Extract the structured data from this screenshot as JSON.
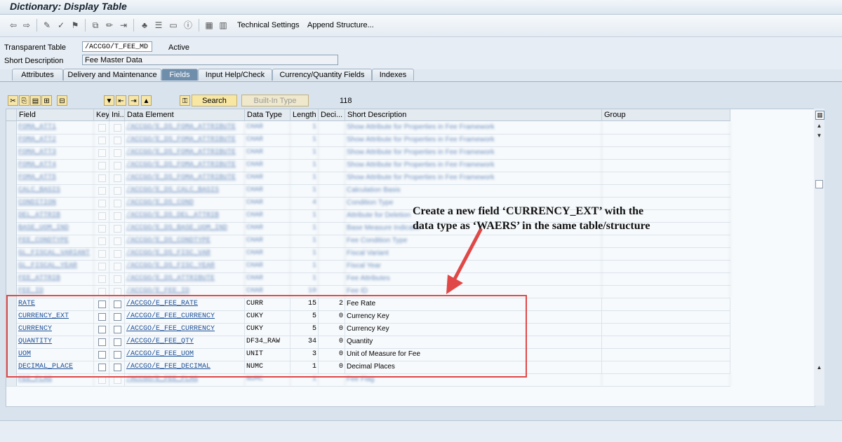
{
  "window": {
    "title": "Dictionary: Display Table"
  },
  "toolbar": {
    "technical_settings": "Technical Settings",
    "append_structure": "Append Structure..."
  },
  "header": {
    "table_type_label": "Transparent Table",
    "table_name": "/ACCGO/T_FEE_MD",
    "status": "Active",
    "short_desc_label": "Short Description",
    "short_desc_value": "Fee Master Data"
  },
  "tabs": [
    {
      "label": "Attributes",
      "active": false
    },
    {
      "label": "Delivery and Maintenance",
      "active": false
    },
    {
      "label": "Fields",
      "active": true
    },
    {
      "label": "Input Help/Check",
      "active": false
    },
    {
      "label": "Currency/Quantity Fields",
      "active": false
    },
    {
      "label": "Indexes",
      "active": false
    }
  ],
  "controls": {
    "search": "Search",
    "builtin_type": "Built-In Type",
    "count": "118"
  },
  "grid": {
    "columns": [
      "Field",
      "Key",
      "Ini...",
      "Data Element",
      "Data Type",
      "Length",
      "Deci...",
      "Short Description",
      "Group"
    ],
    "blurred_rows": [
      {
        "field": "FOMA_ATT1",
        "de": "/ACCGO/E_DS_FOMA_ATTRIBUTE",
        "dtype": "CHAR",
        "len": "1",
        "desc": "Show Attribute for Properties in Fee Framework"
      },
      {
        "field": "FOMA_ATT2",
        "de": "/ACCGO/E_DS_FOMA_ATTRIBUTE",
        "dtype": "CHAR",
        "len": "1",
        "desc": "Show Attribute for Properties in Fee Framework"
      },
      {
        "field": "FOMA_ATT3",
        "de": "/ACCGO/E_DS_FOMA_ATTRIBUTE",
        "dtype": "CHAR",
        "len": "1",
        "desc": "Show Attribute for Properties in Fee Framework"
      },
      {
        "field": "FOMA_ATT4",
        "de": "/ACCGO/E_DS_FOMA_ATTRIBUTE",
        "dtype": "CHAR",
        "len": "1",
        "desc": "Show Attribute for Properties in Fee Framework"
      },
      {
        "field": "FOMA_ATT5",
        "de": "/ACCGO/E_DS_FOMA_ATTRIBUTE",
        "dtype": "CHAR",
        "len": "1",
        "desc": "Show Attribute for Properties in Fee Framework"
      },
      {
        "field": "CALC_BASIS",
        "de": "/ACCGO/E_DS_CALC_BASIS",
        "dtype": "CHAR",
        "len": "1",
        "desc": "Calculation Basis"
      },
      {
        "field": "CONDITION",
        "de": "/ACCGO/E_DS_COND",
        "dtype": "CHAR",
        "len": "4",
        "desc": "Condition Type"
      },
      {
        "field": "DEL_ATTRIB",
        "de": "/ACCGO/E_DS_DEL_ATTRIB",
        "dtype": "CHAR",
        "len": "1",
        "desc": "Attribute for Deletion"
      },
      {
        "field": "BASE_UOM_IND",
        "de": "/ACCGO/E_DS_BASE_UOM_IND",
        "dtype": "CHAR",
        "len": "1",
        "desc": "Base Measure Indicator"
      },
      {
        "field": "FEE_CONDTYPE",
        "de": "/ACCGO/E_DS_CONDTYPE",
        "dtype": "CHAR",
        "len": "1",
        "desc": "Fee Condition Type"
      },
      {
        "field": "GL_FISCAL_VARIANT",
        "de": "/ACCGO/E_DS_FISC_VAR",
        "dtype": "CHAR",
        "len": "1",
        "desc": "Fiscal Variant"
      },
      {
        "field": "GL_FISCAL_YEAR",
        "de": "/ACCGO/E_DS_FISC_YEAR",
        "dtype": "CHAR",
        "len": "1",
        "desc": "Fiscal Year"
      },
      {
        "field": "FEE_ATTRIB",
        "de": "/ACCGO/E_DS_ATTRIBUTE",
        "dtype": "CHAR",
        "len": "1",
        "desc": "Fee Attributes"
      },
      {
        "field": "FEE_ID",
        "de": "/ACCGO/E_FEE_ID",
        "dtype": "CHAR",
        "len": "10",
        "desc": "Fee ID"
      }
    ],
    "rows": [
      {
        "field": "RATE",
        "de": "/ACCGO/E_FEE_RATE",
        "dtype": "CURR",
        "len": "15",
        "dec": "2",
        "desc": "Fee Rate"
      },
      {
        "field": "CURRENCY_EXT",
        "de": "/ACCGO/E_FEE_CURRENCY",
        "dtype": "CUKY",
        "len": "5",
        "dec": "0",
        "desc": "Currency Key"
      },
      {
        "field": "CURRENCY",
        "de": "/ACCGO/E_FEE_CURRENCY",
        "dtype": "CUKY",
        "len": "5",
        "dec": "0",
        "desc": "Currency Key"
      },
      {
        "field": "QUANTITY",
        "de": "/ACCGO/E_FEE_QTY",
        "dtype": "DF34_RAW",
        "len": "34",
        "dec": "0",
        "desc": "Quantity"
      },
      {
        "field": "UOM",
        "de": "/ACCGO/E_FEE_UOM",
        "dtype": "UNIT",
        "len": "3",
        "dec": "0",
        "desc": "Unit of Measure for Fee"
      },
      {
        "field": "DECIMAL_PLACE",
        "de": "/ACCGO/E_FEE_DECIMAL",
        "dtype": "NUMC",
        "len": "1",
        "dec": "0",
        "desc": "Decimal Places"
      }
    ],
    "trailing_blurred_row": {
      "field": "FEE_FLAG",
      "de": "/ACCGO/E_FEE_FLAG",
      "dtype": "NUMC",
      "len": "1",
      "desc": "Fee Flag"
    }
  },
  "annotation": {
    "line1": "Create a new field ‘CURRENCY_EXT’ with the",
    "line2": "data type as ‘WAERS’ in the same table/structure"
  },
  "colors": {
    "annotation_red": "#e04848",
    "active_tab": "#6e8eab",
    "link_blue": "#1c4f96"
  }
}
